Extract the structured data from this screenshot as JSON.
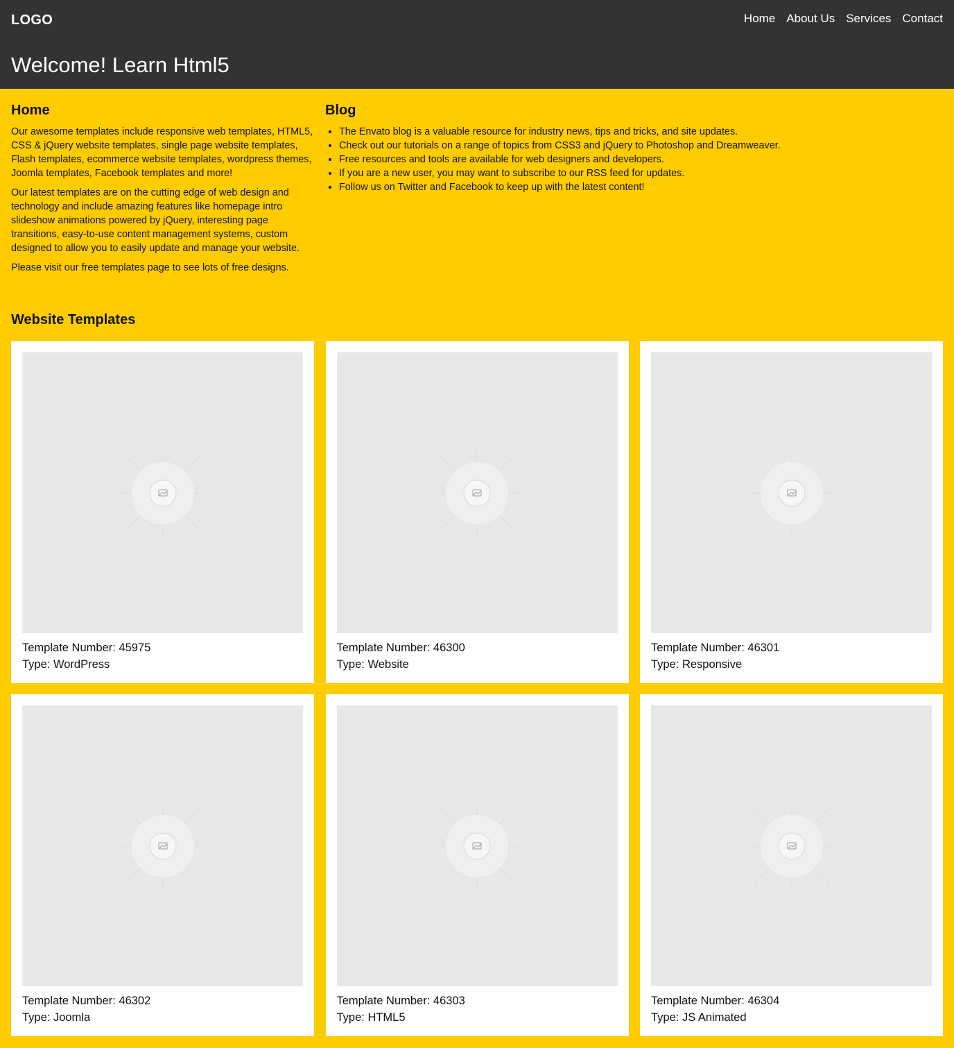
{
  "header": {
    "logo": "LOGO",
    "nav": [
      "Home",
      "About Us",
      "Services",
      "Contact"
    ],
    "welcome": "Welcome! Learn Html5"
  },
  "home": {
    "title": "Home",
    "paragraphs": [
      "Our awesome templates include responsive web templates, HTML5, CSS & jQuery website templates, single page website templates, Flash templates, ecommerce website templates, wordpress themes, Joomla templates, Facebook templates and more!",
      "Our latest templates are on the cutting edge of web design and technology and include amazing features like homepage intro slideshow animations powered by jQuery, interesting page transitions, easy-to-use content management systems, custom designed to allow you to easily update and manage your website.",
      "Please visit our free templates page to see lots of free designs."
    ]
  },
  "blog": {
    "title": "Blog",
    "items": [
      "The Envato blog is a valuable resource for industry news, tips and tricks, and site updates.",
      "Check out our tutorials on a range of topics from CSS3 and jQuery to Photoshop and Dreamweaver.",
      "Free resources and tools are available for web designers and developers.",
      "If you are a new user, you may want to subscribe to our RSS feed for updates.",
      "Follow us on Twitter and Facebook to keep up with the latest content!"
    ]
  },
  "templates": {
    "title": "Website Templates",
    "cards": [
      {
        "number": "Template Number: 45975",
        "type": "Type: WordPress"
      },
      {
        "number": "Template Number: 46300",
        "type": "Type: Website"
      },
      {
        "number": "Template Number: 46301",
        "type": "Type: Responsive"
      },
      {
        "number": "Template Number: 46302",
        "type": "Type: Joomla"
      },
      {
        "number": "Template Number: 46303",
        "type": "Type: HTML5"
      },
      {
        "number": "Template Number: 46304",
        "type": "Type: JS Animated"
      }
    ]
  },
  "colors": {
    "header_bg": "#333333",
    "page_bg": "#ffcc00",
    "card_bg": "#ffffff",
    "thumb_bg": "#e8e8e8"
  }
}
